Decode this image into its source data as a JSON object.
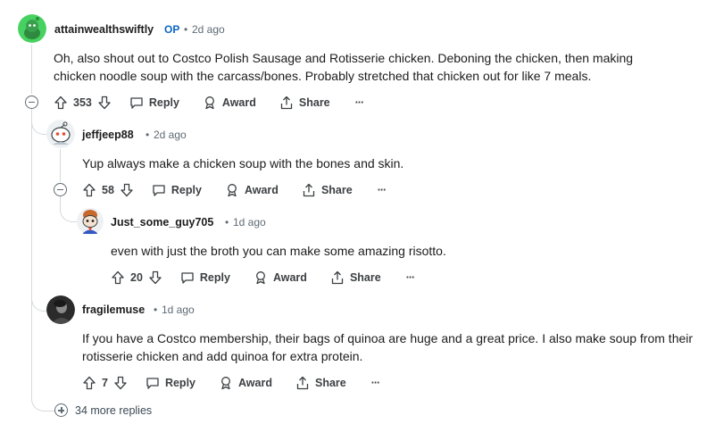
{
  "comments": [
    {
      "username": "attainwealthswiftly",
      "op_badge": "OP",
      "time": "2d ago",
      "body": "Oh, also shout out to Costco Polish Sausage and Rotisserie chicken. Deboning the chicken, then making chicken noodle soup with the carcass/bones. Probably stretched that chicken out for like 7 meals.",
      "votes": "353",
      "avatar_color": "#46d160"
    },
    {
      "username": "jeffjeep88",
      "time": "2d ago",
      "body": "Yup always make a chicken soup with the bones and skin.",
      "votes": "58"
    },
    {
      "username": "Just_some_guy705",
      "time": "1d ago",
      "body": "even with just the broth you can make some amazing risotto.",
      "votes": "20"
    },
    {
      "username": "fragilemuse",
      "time": "1d ago",
      "body": "If you have a Costco membership, their bags of quinoa are huge and a great price. I also make soup from their rotisserie chicken and add quinoa for extra protein.",
      "votes": "7"
    }
  ],
  "actions": {
    "reply": "Reply",
    "award": "Award",
    "share": "Share",
    "more": "···"
  },
  "more_replies": "34 more replies",
  "separator": "•"
}
